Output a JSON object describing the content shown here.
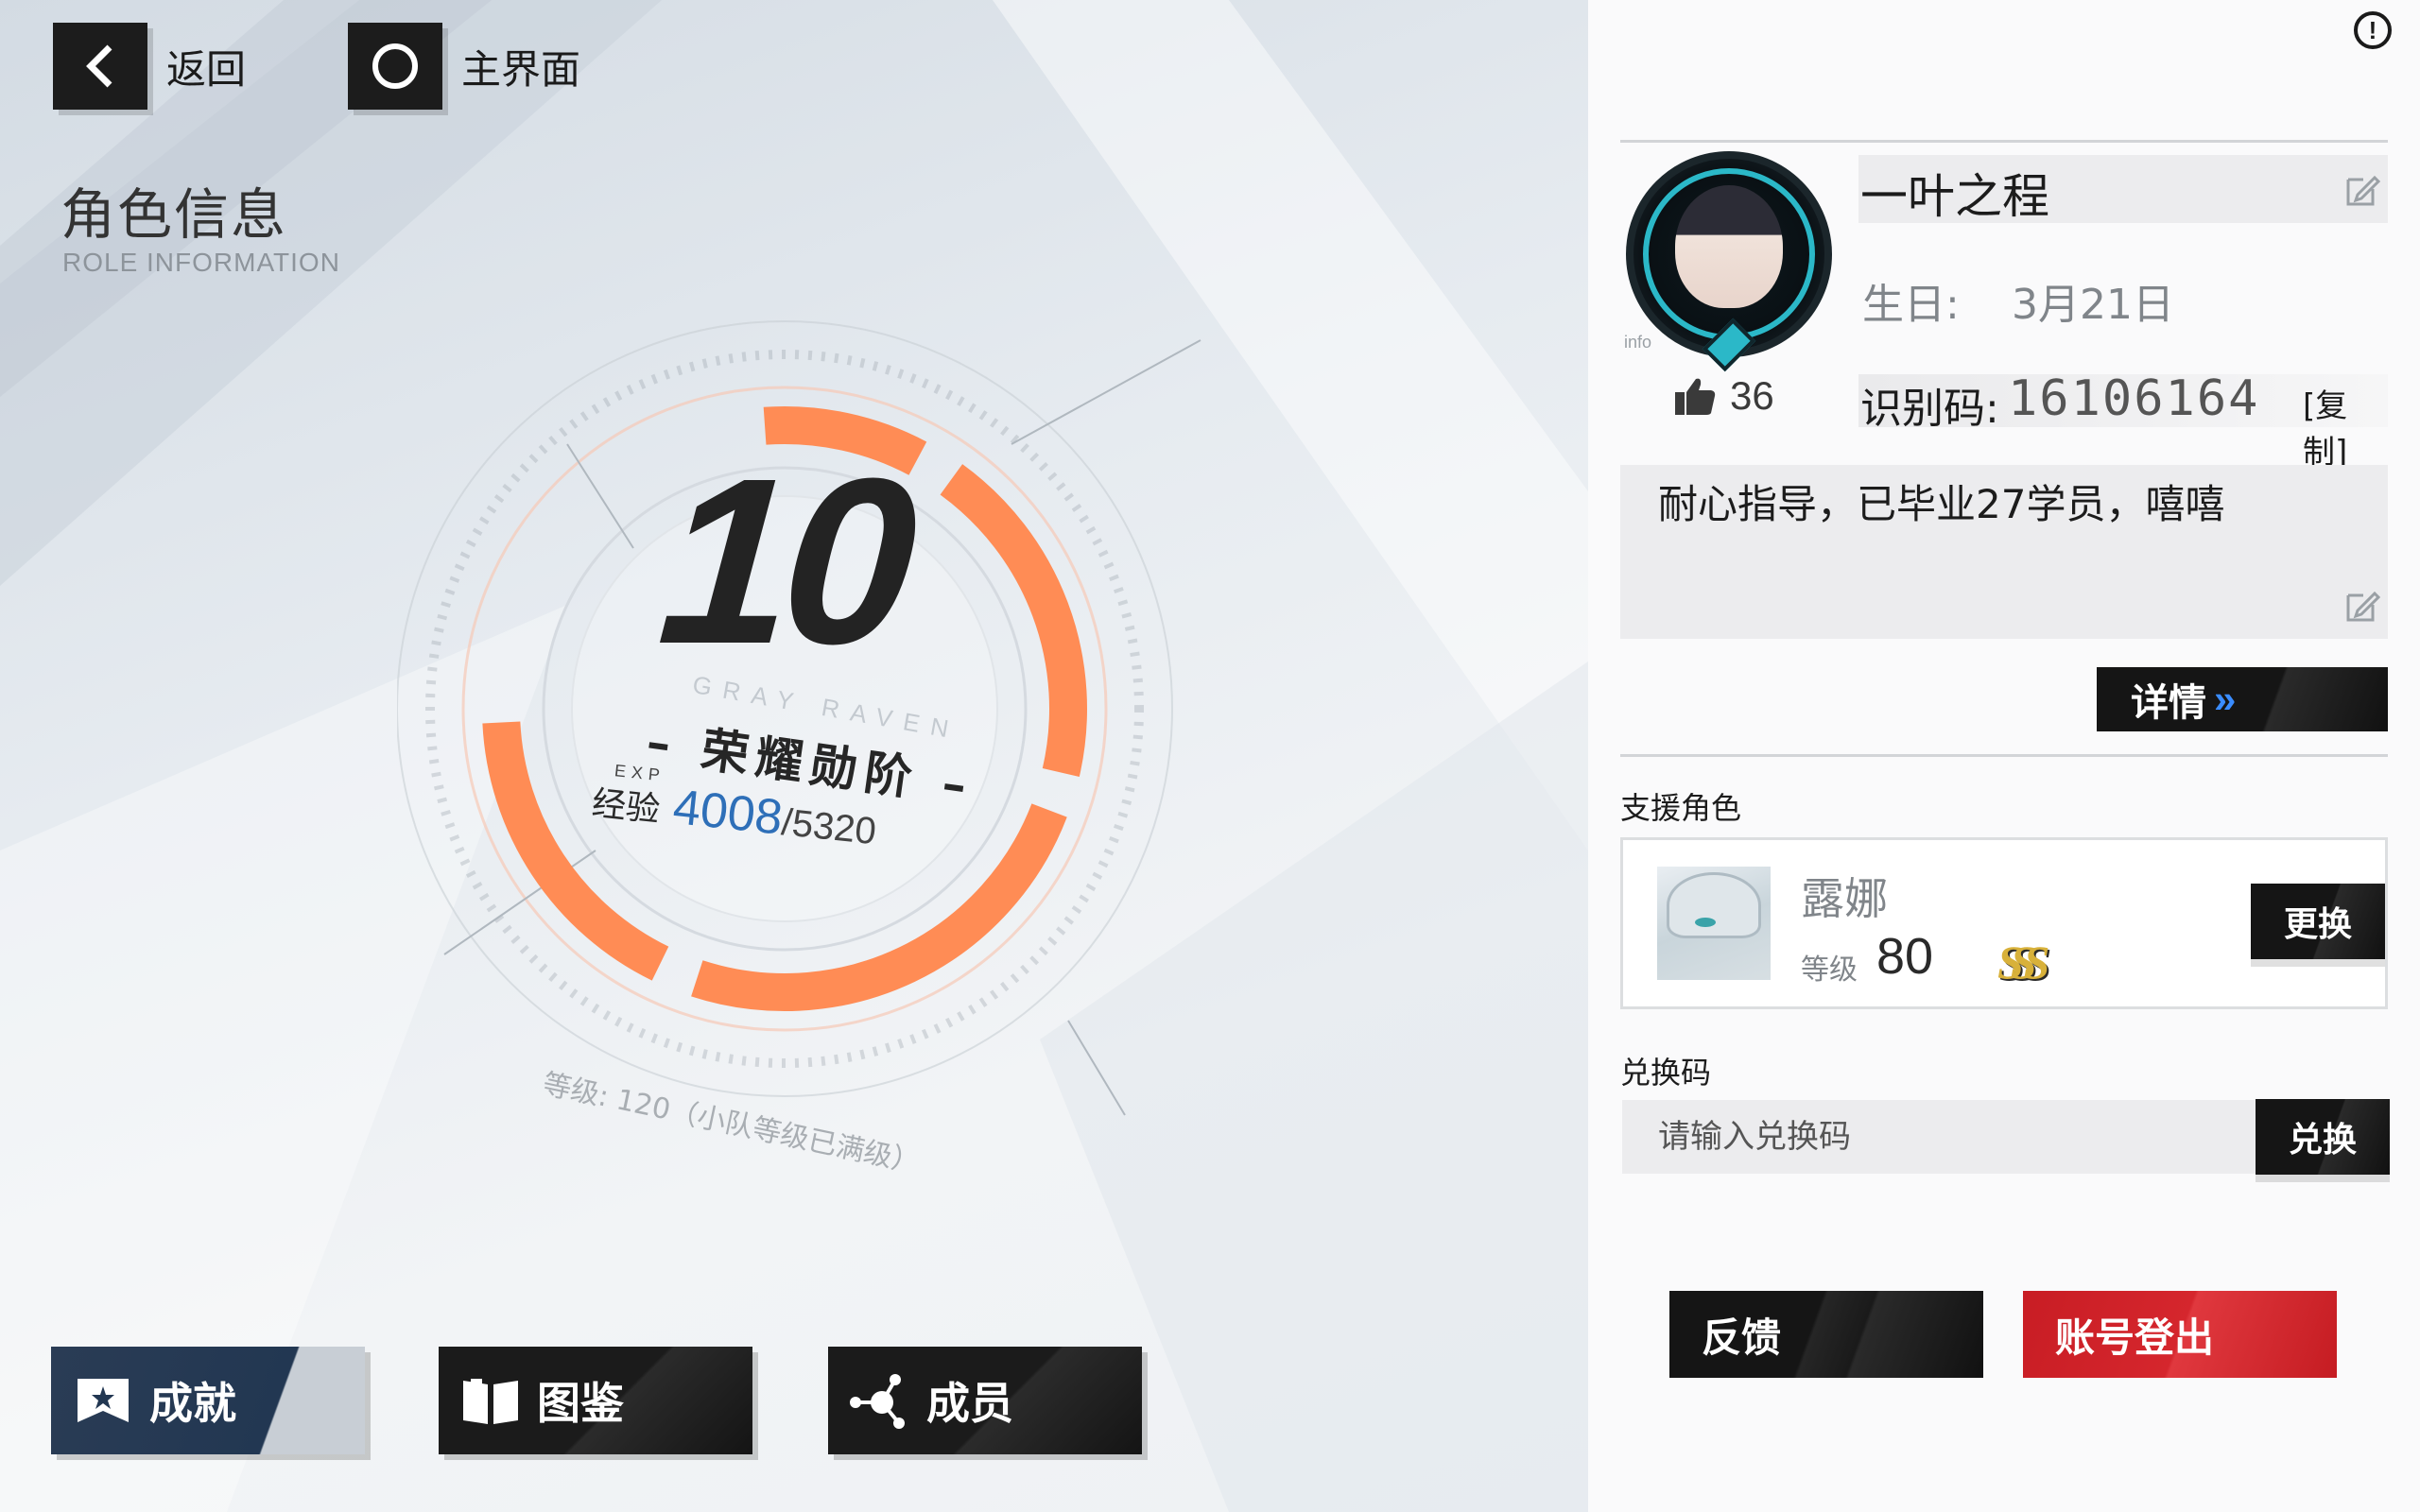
{
  "nav": {
    "back_label": "返回",
    "home_label": "主界面"
  },
  "header": {
    "title_cn": "角色信息",
    "title_en": "ROLE INFORMATION"
  },
  "rank": {
    "level": "10",
    "title": "– 荣耀勋阶 –",
    "exp_label_small": "EXP",
    "exp_label": "经验",
    "exp_current": "4008",
    "exp_max": "/5320",
    "exp_progress": 0.7534,
    "watermark": "GRAY RAVEN",
    "team_level_text": "等级: 120（小队等级已满级）"
  },
  "bottom_nav": [
    {
      "label": "成就",
      "icon": "achievement-flag-icon"
    },
    {
      "label": "图鉴",
      "icon": "book-icon"
    },
    {
      "label": "成员",
      "icon": "network-icon"
    }
  ],
  "profile": {
    "name": "一叶之程",
    "birthday_label": "生日:",
    "birthday": "3月21日",
    "likes": "36",
    "uid_label": "识别码:",
    "uid": "16106164",
    "copy_label": "[复制]",
    "avatar_tag": "info",
    "signature": "耐心指导，已毕业27学员，嘻嘻",
    "detail_label": "详情",
    "detail_chevron": "»"
  },
  "support": {
    "section_label": "支援角色",
    "name": "露娜",
    "level_label": "等级",
    "level": "80",
    "rank": "SSS",
    "change_label": "更换"
  },
  "redeem": {
    "section_label": "兑换码",
    "placeholder": "请输入兑换码",
    "redeem_label": "兑换"
  },
  "actions": {
    "feedback_label": "反馈",
    "logout_label": "账号登出"
  },
  "colors": {
    "accent_orange": "#ff8c55",
    "exp_blue": "#2e6fb8",
    "logout_red": "#d5262d",
    "detail_chevron": "#3a8cff"
  }
}
